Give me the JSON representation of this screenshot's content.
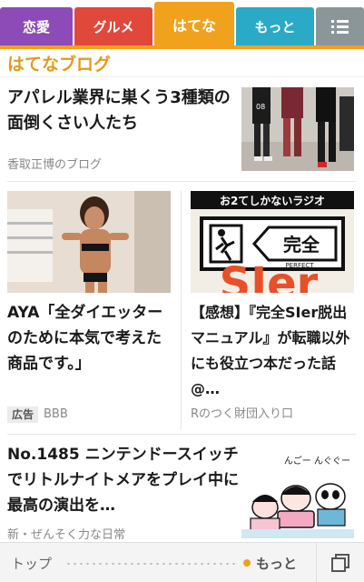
{
  "tabs": {
    "love": "恋愛",
    "gourmet": "グルメ",
    "hatena": "はてな",
    "more": "もっと",
    "menu_icon": "list-menu-icon"
  },
  "section": {
    "title": "はてなブログ"
  },
  "articles": [
    {
      "title": "アパレル業界に巣くう3種類の面倒くさい人たち",
      "source": "香取正博のブログ",
      "thumbnail": "fashion-photo"
    },
    {
      "title": "AYA「全ダイエッターのために本気で考えた商品です。」",
      "ad_label": "広告",
      "sponsor": "BBB",
      "thumbnail": "fitness-model-photo"
    },
    {
      "title": "【感想】『完全SIer脱出マニュアル』が転職以外にも役立つ本だった話@…",
      "source": "Rのつく財団入り口",
      "thumbnail": "book-cover",
      "thumb_text_top": "お2てしかないラジオ",
      "thumb_text_sign": "完全",
      "thumb_text_perfect": "PERFECT",
      "thumb_text_big": "SIer"
    },
    {
      "title": "No.1485 ニンテンドースイッチでリトルナイトメアをプレイ中に最高の演出を…",
      "source": "新・ぜんそく力な日常",
      "thumbnail": "manga-illustration",
      "thumb_text_speech": "んごー んぐぐー"
    }
  ],
  "bottom_nav": {
    "top": "トップ",
    "more": "もっと",
    "tabs_icon": "tabs-icon"
  },
  "colors": {
    "love": "#8c4bb6",
    "gourmet": "#e0483c",
    "hatena": "#f0a21c",
    "more": "#2aaac6",
    "menu": "#8b9699"
  }
}
